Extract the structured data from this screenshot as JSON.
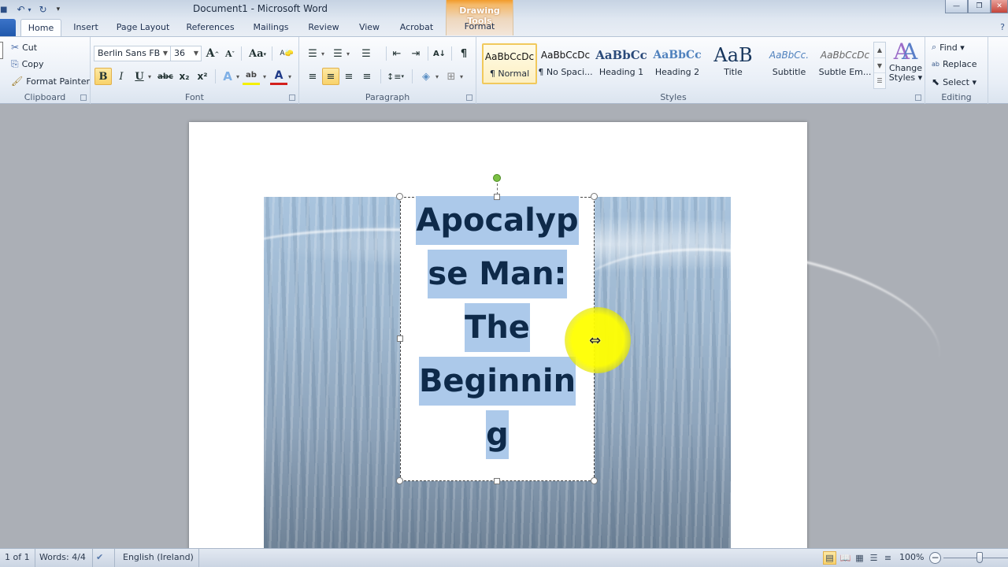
{
  "window": {
    "title": "Document1  -  Microsoft Word",
    "context_tab_group": "Drawing Tools",
    "controls": {
      "minimize": "—",
      "restore": "❐",
      "close": "✕"
    }
  },
  "quick_access": {
    "save": "💾",
    "undo": "↶",
    "redo": "↻",
    "customize": "▾"
  },
  "tabs": [
    {
      "label": "",
      "name": "file"
    },
    {
      "label": "Home",
      "active": true
    },
    {
      "label": "Insert"
    },
    {
      "label": "Page Layout"
    },
    {
      "label": "References"
    },
    {
      "label": "Mailings"
    },
    {
      "label": "Review"
    },
    {
      "label": "View"
    },
    {
      "label": "Acrobat"
    },
    {
      "label": "Format"
    }
  ],
  "ribbon": {
    "clipboard": {
      "label": "Clipboard",
      "cut": "Cut",
      "copy": "Copy",
      "format_painter": "Format Painter"
    },
    "font": {
      "label": "Font",
      "font_name": "Berlin Sans FB",
      "font_size": "36",
      "grow": "A",
      "shrink": "A",
      "change_case": "Aa",
      "clear_format": "A",
      "bold": "B",
      "italic": "I",
      "underline": "U",
      "strikethrough": "abc",
      "subscript": "x₂",
      "superscript": "x²",
      "text_effects": "A",
      "highlight": "ab",
      "font_color": "A"
    },
    "paragraph": {
      "label": "Paragraph",
      "bullets": "☰",
      "numbering": "☰",
      "multilevel": "☰",
      "decrease_indent": "⇤",
      "increase_indent": "⇥",
      "sort": "A↓",
      "show_marks": "¶",
      "align_left": "≡",
      "align_center": "≡",
      "align_right": "≡",
      "justify": "≡",
      "line_spacing": "↕≡",
      "shading": "◈",
      "borders": "⊞"
    },
    "styles": {
      "label": "Styles",
      "items": [
        {
          "sample": "AaBbCcDc",
          "name": "¶ Normal",
          "selected": true
        },
        {
          "sample": "AaBbCcDc",
          "name": "¶ No Spaci..."
        },
        {
          "sample": "AaBbCc",
          "name": "Heading 1"
        },
        {
          "sample": "AaBbCc",
          "name": "Heading 2"
        },
        {
          "sample": "AaB",
          "name": "Title"
        },
        {
          "sample": "AaBbCc.",
          "name": "Subtitle"
        },
        {
          "sample": "AaBbCcDc",
          "name": "Subtle Em..."
        }
      ],
      "change_styles": "Change Styles",
      "change_styles_line1": "Change",
      "change_styles_line2": "Styles ▾"
    },
    "editing": {
      "label": "Editing",
      "find": "Find ▾",
      "replace": "Replace",
      "select": "Select ▾"
    }
  },
  "document": {
    "textbox_lines": [
      "Apocalyp",
      "se Man:",
      "The",
      "Beginnin",
      "g"
    ],
    "highlight_color": "#acc9ea",
    "text_color": "#0e2a4a"
  },
  "statusbar": {
    "page": "1 of 1",
    "words": "Words: 4/4",
    "language": "English (Ireland)",
    "zoom": "100%",
    "zoom_minus": "−",
    "zoom_level_percent": 100
  }
}
